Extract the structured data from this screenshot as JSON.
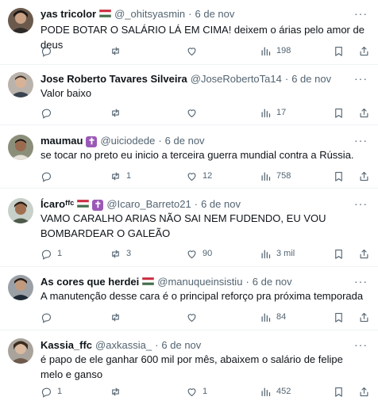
{
  "tweets": [
    {
      "name": "yas tricolor",
      "emoji": "flag-hungary",
      "handle": "@_ohitsyasmin",
      "dot": "·",
      "date": "6 de nov",
      "text": "PODE BOTAR O SALÁRIO LÁ EM CIMA! deixem o árias pelo amor de deus",
      "replies": "",
      "retweets": "",
      "likes": "",
      "views": "198"
    },
    {
      "name": "Jose Roberto Tavares Silveira",
      "emoji": "",
      "handle": "@JoseRobertoTa14",
      "dot": "·",
      "date": "6 de nov",
      "text": "Valor baixo",
      "replies": "",
      "retweets": "",
      "likes": "",
      "views": "17"
    },
    {
      "name": "maumau",
      "emoji": "latin-cross",
      "handle": "@uiciodede",
      "dot": "·",
      "date": "6 de nov",
      "text": "se tocar no preto eu inicio a terceira guerra mundial contra a Rússia.",
      "replies": "",
      "retweets": "1",
      "likes": "12",
      "views": "758"
    },
    {
      "name": "Ícaroᶠᶠᶜ",
      "emoji": "flags-cross",
      "handle": "@Icaro_Barreto21",
      "dot": "·",
      "date": "6 de nov",
      "text": "VAMO CARALHO ARIAS NÃO SAI NEM FUDENDO, EU VOU BOMBARDEAR O GALEÃO",
      "replies": "1",
      "retweets": "3",
      "likes": "90",
      "views": "3 mil"
    },
    {
      "name": "As cores que herdei",
      "emoji": "flag-hungary",
      "handle": "@manuqueinsistiu",
      "dot": "·",
      "date": "6 de nov",
      "text": "A manutenção desse cara é o principal reforço pra próxima temporada",
      "replies": "",
      "retweets": "",
      "likes": "",
      "views": "84"
    },
    {
      "name": "Kassia_ffc",
      "emoji": "",
      "handle": "@axkassia_",
      "dot": "·",
      "date": "6 de nov",
      "text": "é papo de ele ganhar 600 mil por mês, abaixem o salário de felipe melo e ganso",
      "replies": "1",
      "retweets": "",
      "likes": "1",
      "views": "452"
    }
  ],
  "colors": {
    "text": "#0f1419",
    "muted": "#536471",
    "divider": "#eff3f4",
    "flag_red": "#cd2a3e",
    "flag_white": "#ffffff",
    "flag_green": "#436f4d",
    "cross_purple": "#9b59b6"
  },
  "icons": [
    "more-icon",
    "reply-icon",
    "retweet-icon",
    "like-icon",
    "views-icon",
    "bookmark-icon",
    "share-icon"
  ]
}
